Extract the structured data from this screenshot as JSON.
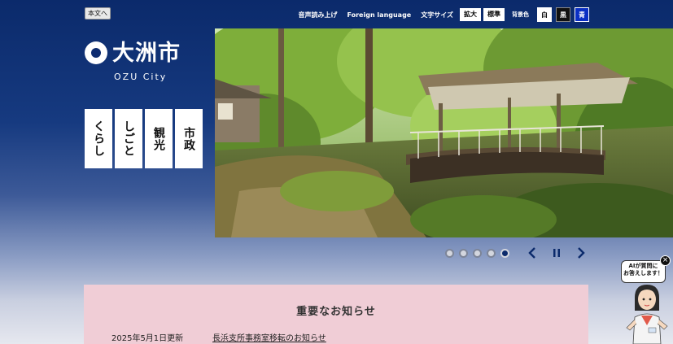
{
  "skip_link": "本文へ",
  "header": {
    "read_aloud": "音声読み上げ",
    "foreign_language": "Foreign language",
    "text_size_label": "文字サイズ",
    "text_size_enlarge": "拡大",
    "text_size_standard": "標準",
    "bg_color_label": "背景色",
    "bg_white": "白",
    "bg_black": "黒",
    "bg_blue": "青"
  },
  "logo": {
    "name_jp": "大洲市",
    "name_en": "OZU City"
  },
  "categories": [
    {
      "label": "くらし"
    },
    {
      "label": "しごと"
    },
    {
      "label": "観光"
    },
    {
      "label": "市政"
    }
  ],
  "slider": {
    "slide_count": 5,
    "active_index": 4
  },
  "notices": {
    "title": "重要なお知らせ",
    "items": [
      {
        "date": "2025年5月1日更新",
        "text": "長浜支所事務室移転のお知らせ"
      }
    ]
  },
  "ai_assistant": {
    "line1": "AIが質問に",
    "line2": "お答えします！",
    "close": "×"
  },
  "icons": {
    "prev": "chevron-left-icon",
    "pause": "pause-icon",
    "next": "chevron-right-icon",
    "close": "close-icon"
  },
  "colors": {
    "brand_navy": "#0b2a6b",
    "notice_bg": "#f0cdd6",
    "bg_blue_button": "#0a2fc4"
  }
}
